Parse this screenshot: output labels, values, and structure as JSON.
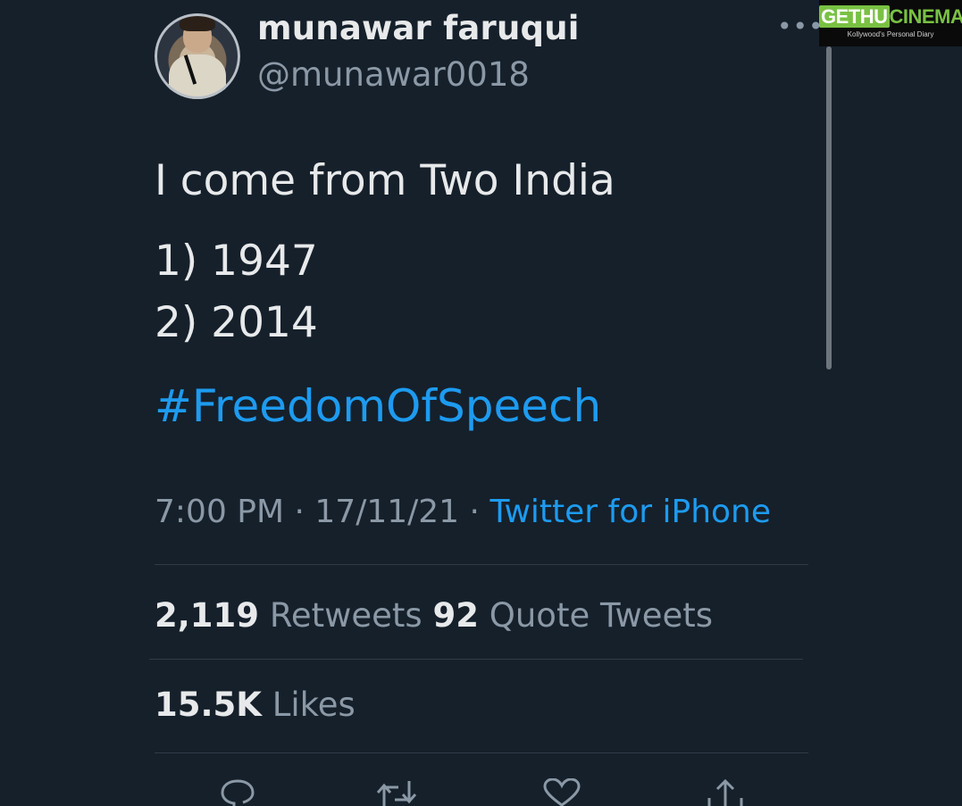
{
  "author": {
    "display_name": "munawar faruqui",
    "handle": "@munawar0018"
  },
  "tweet": {
    "lines": [
      "I come from Two India",
      "1) 1947",
      "2) 2014"
    ],
    "hashtag": "#FreedomOfSpeech",
    "time": "7:00 PM",
    "date": "17/11/21",
    "source": "Twitter for iPhone"
  },
  "stats": {
    "retweets_count": "2,119",
    "retweets_label": "Retweets",
    "quotes_count": "92",
    "quotes_label": "Quote Tweets",
    "likes_count": "15.5K",
    "likes_label": "Likes"
  },
  "watermark": {
    "brand": "GETHUCINEMA",
    "tagline": "Kollywood's Personal Diary"
  },
  "icons": {
    "more": "more-dots-icon",
    "reply": "reply-icon",
    "retweet": "retweet-icon",
    "like": "heart-icon",
    "share": "share-icon"
  },
  "colors": {
    "background": "#15202b",
    "link": "#1d9bf0",
    "secondary_text": "#8b98a5"
  }
}
